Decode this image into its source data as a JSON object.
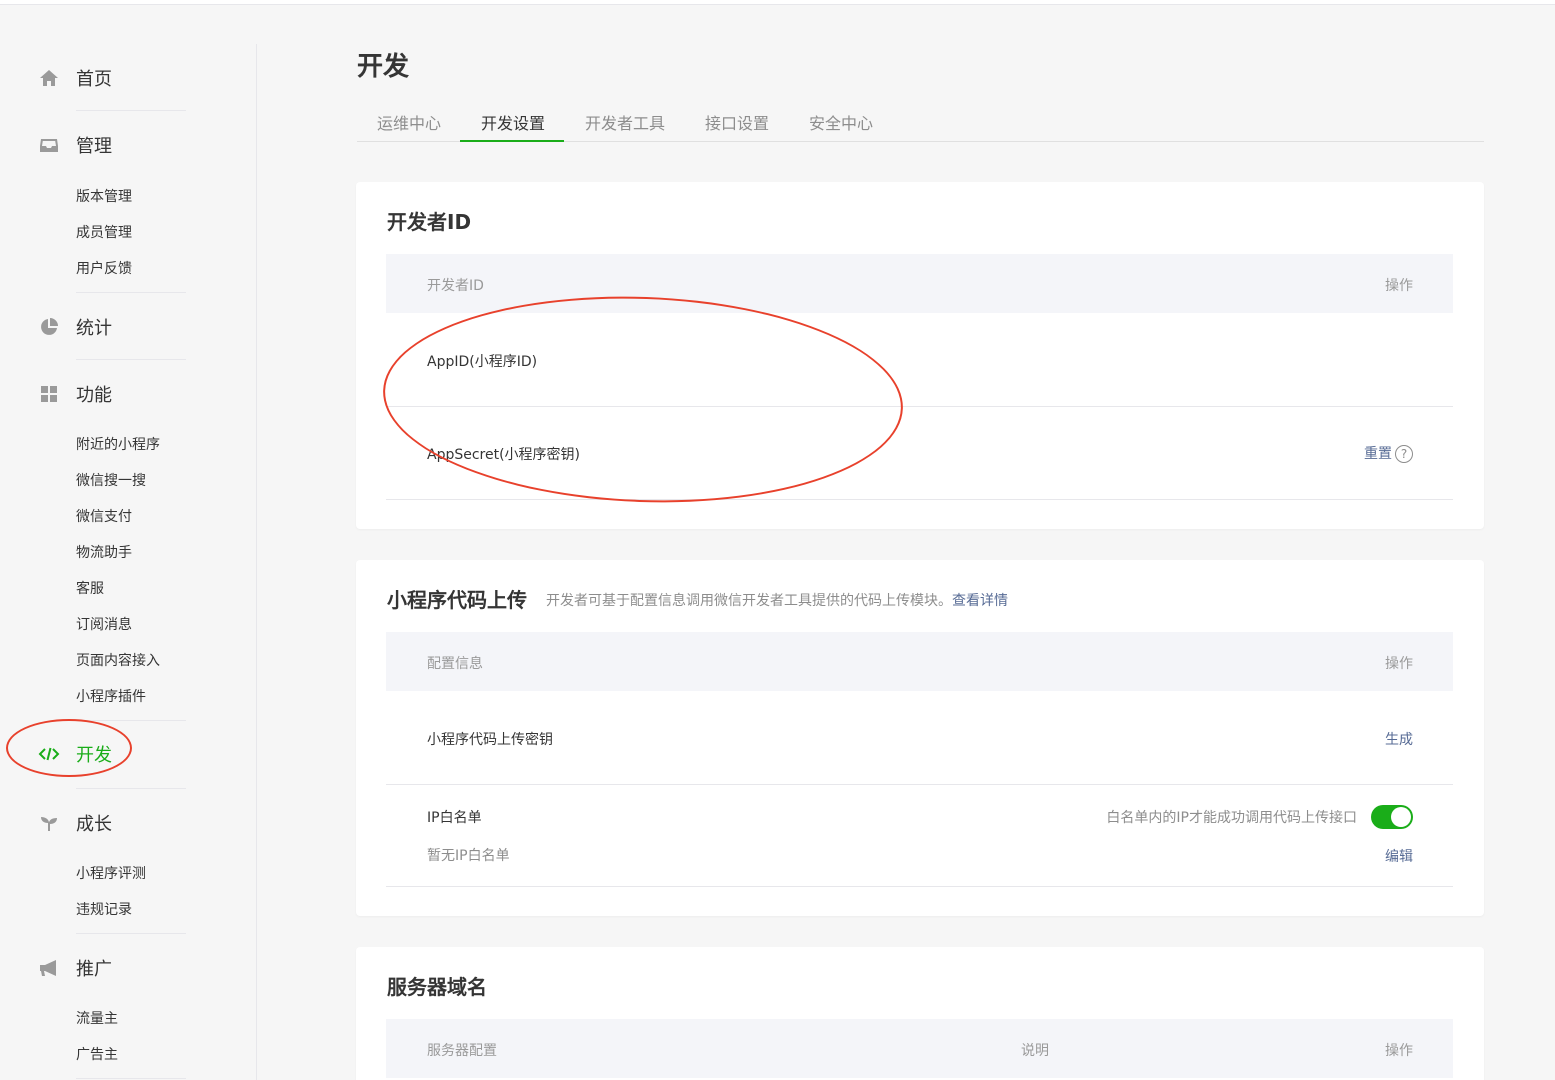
{
  "sidebar": {
    "home": "首页",
    "manage": "管理",
    "manage_items": [
      "版本管理",
      "成员管理",
      "用户反馈"
    ],
    "stats": "统计",
    "features": "功能",
    "feature_items": [
      "附近的小程序",
      "微信搜一搜",
      "微信支付",
      "物流助手",
      "客服",
      "订阅消息",
      "页面内容接入",
      "小程序插件"
    ],
    "develop": "开发",
    "growth": "成长",
    "growth_items": [
      "小程序评测",
      "违规记录"
    ],
    "promote": "推广",
    "promote_items": [
      "流量主",
      "广告主"
    ]
  },
  "page": {
    "title": "开发",
    "tabs": [
      "运维中心",
      "开发设置",
      "开发者工具",
      "接口设置",
      "安全中心"
    ],
    "active_tab": 1
  },
  "developer_id": {
    "title": "开发者ID",
    "col_id": "开发者ID",
    "col_action": "操作",
    "rows": [
      {
        "label": "AppID(小程序ID)"
      },
      {
        "label": "AppSecret(小程序密钥)",
        "action": "重置"
      }
    ]
  },
  "code_upload": {
    "title": "小程序代码上传",
    "desc": "开发者可基于配置信息调用微信开发者工具提供的代码上传模块。",
    "desc_link": "查看详情",
    "col_config": "配置信息",
    "col_action": "操作",
    "key_label": "小程序代码上传密钥",
    "key_action": "生成",
    "ip_label": "IP白名单",
    "ip_hint": "白名单内的IP才能成功调用代码上传接口",
    "ip_toggle_on": true,
    "ip_empty": "暂无IP白名单",
    "ip_action": "编辑"
  },
  "server_domain": {
    "title": "服务器域名",
    "col_config": "服务器配置",
    "col_desc": "说明",
    "col_action": "操作"
  },
  "colors": {
    "accent": "#1aad19",
    "link": "#576b95",
    "annotation": "#e8412c"
  }
}
